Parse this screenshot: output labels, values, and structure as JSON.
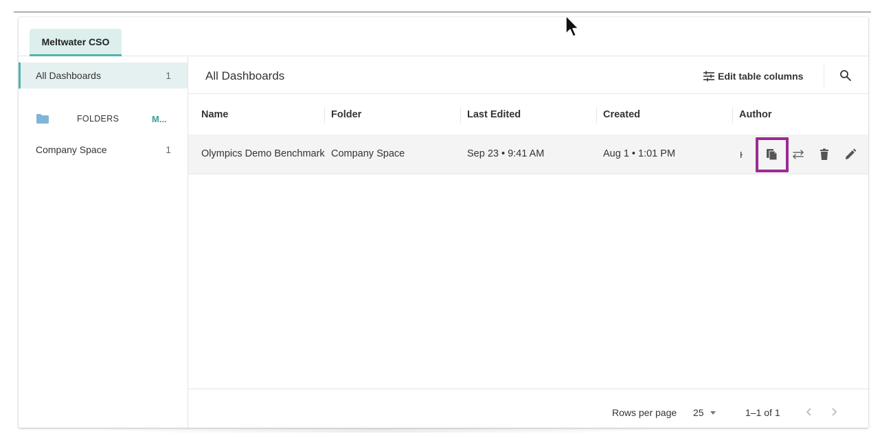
{
  "tabs": {
    "active_label": "Meltwater CSO"
  },
  "sidebar": {
    "all": {
      "label": "All Dashboards",
      "count": "1"
    },
    "folders": {
      "label": "FOLDERS",
      "more": "M..."
    },
    "items": [
      {
        "label": "Company Space",
        "count": "1"
      }
    ]
  },
  "main": {
    "title": "All Dashboards",
    "edit_columns_label": "Edit table columns"
  },
  "table": {
    "columns": [
      "Name",
      "Folder",
      "Last Edited",
      "Created",
      "Author"
    ],
    "rows": [
      {
        "name": "Olympics Demo Benchmark",
        "folder": "Company Space",
        "last_edited": "Sep 23 • 9:41 AM",
        "created": "Aug 1 • 1:01 PM",
        "author": "H"
      }
    ]
  },
  "footer": {
    "rows_per_page_label": "Rows per page",
    "rows_per_page_value": "25",
    "page_range": "1–1 of 1"
  },
  "colors": {
    "accent": "#4fb3ad",
    "highlight": "#9a2b94",
    "tab_bg": "#dcefed"
  }
}
